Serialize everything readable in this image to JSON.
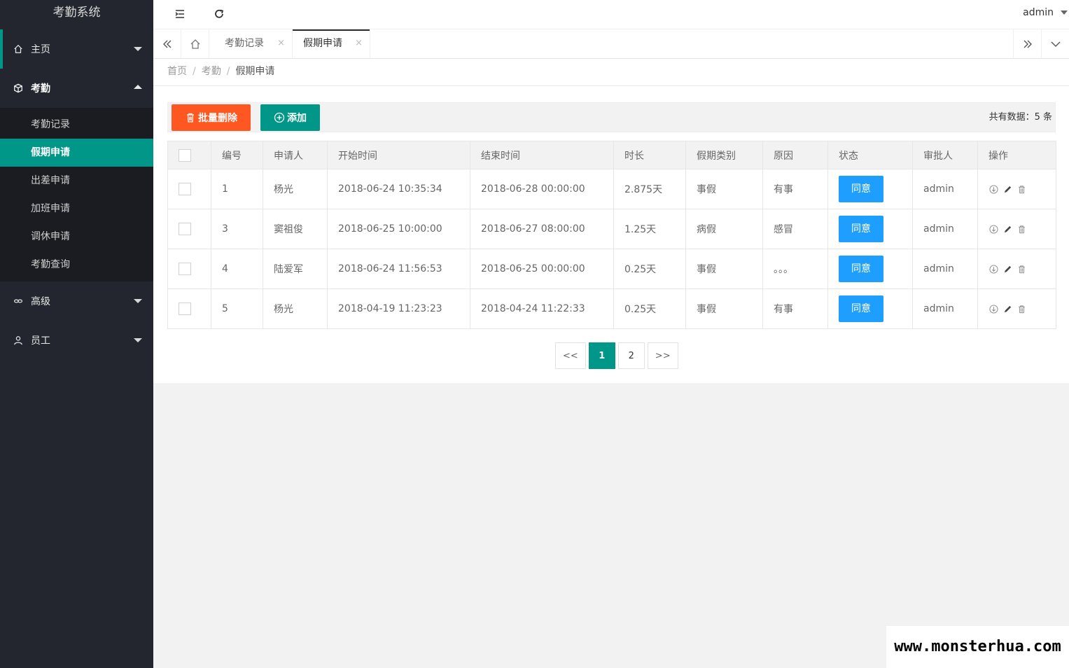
{
  "app": {
    "title": "考勤系统"
  },
  "sidebar": {
    "items": [
      {
        "label": "主页",
        "icon": "home-icon",
        "expanded": false
      },
      {
        "label": "考勤",
        "icon": "cube-icon",
        "expanded": true
      },
      {
        "label": "高级",
        "icon": "link-icon",
        "expanded": false
      },
      {
        "label": "员工",
        "icon": "user-icon",
        "expanded": false
      }
    ],
    "subitems": [
      "考勤记录",
      "假期申请",
      "出差申请",
      "加班申请",
      "调休申请",
      "考勤查询"
    ],
    "selected_sub": "假期申请"
  },
  "header": {
    "user": "admin"
  },
  "tabs": [
    {
      "label": "考勤记录",
      "close": "×"
    },
    {
      "label": "假期申请",
      "close": "×"
    }
  ],
  "breadcrumb": {
    "c1": "首页",
    "c2": "考勤",
    "c3": "假期申请",
    "sep": "/"
  },
  "toolbar": {
    "delete_label": "批量删除",
    "add_label": "添加",
    "total": "共有数据：5 条"
  },
  "table": {
    "headers": [
      "编号",
      "申请人",
      "开始时间",
      "结束时间",
      "时长",
      "假期类别",
      "原因",
      "状态",
      "审批人",
      "操作"
    ],
    "rows": [
      {
        "id": "1",
        "applicant": "杨光",
        "start": "2018-06-24 10:35:34",
        "end": "2018-06-28 00:00:00",
        "duration": "2.875天",
        "type": "事假",
        "reason": "有事",
        "status": "同意",
        "approver": "admin"
      },
      {
        "id": "3",
        "applicant": "窦祖俊",
        "start": "2018-06-25 10:00:00",
        "end": "2018-06-27 08:00:00",
        "duration": "1.25天",
        "type": "病假",
        "reason": "感冒",
        "status": "同意",
        "approver": "admin"
      },
      {
        "id": "4",
        "applicant": "陆爱军",
        "start": "2018-06-24 11:56:53",
        "end": "2018-06-25 00:00:00",
        "duration": "0.25天",
        "type": "事假",
        "reason": "。。。",
        "status": "同意",
        "approver": "admin"
      },
      {
        "id": "5",
        "applicant": "杨光",
        "start": "2018-04-19 11:23:23",
        "end": "2018-04-24 11:22:33",
        "duration": "0.25天",
        "type": "事假",
        "reason": "有事",
        "status": "同意",
        "approver": "admin"
      }
    ]
  },
  "pagination": {
    "prev": "<<",
    "pages": [
      "1",
      "2"
    ],
    "current": "1",
    "next": ">>"
  },
  "watermark": "www.monsterhua.com",
  "colors": {
    "accent": "#009688",
    "danger": "#ff5722",
    "primary": "#1e9fff",
    "sidebar": "#23262e"
  }
}
